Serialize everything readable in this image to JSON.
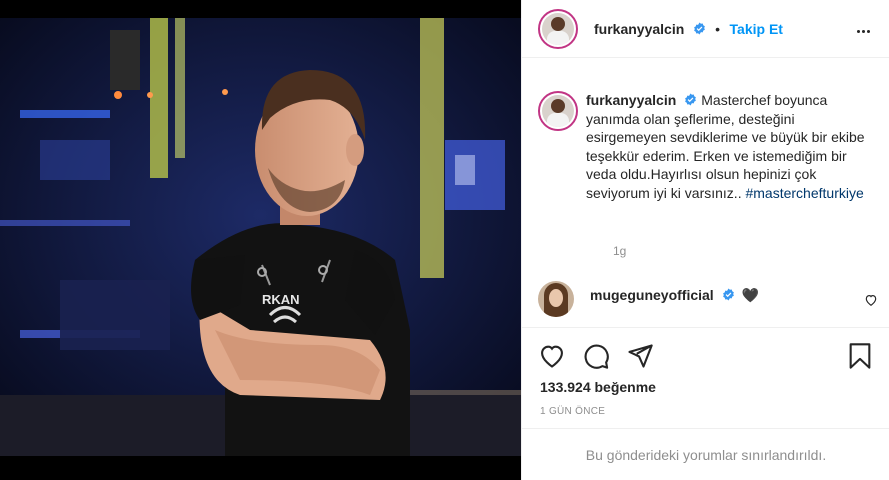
{
  "post": {
    "username": "furkanyyalcin",
    "follow_label": "Takip Et",
    "separator": "•",
    "caption": "Masterchef boyunca yanımda olan şeflerime, desteğini esirgemeyen sevdiklerime ve büyük bir ekibe teşekkür ederim. Erken ve istemediğim bir veda oldu.Hayırlısı olsun hepinizi çok seviyorum iyi ki varsınız..",
    "hashtag": "#masterchefturkiye",
    "hashtag_display": "#masterchefturkiye",
    "caption_time": "1g",
    "likes": "133.924 beğenme",
    "date": "1 GÜN ÖNCE",
    "comments_restricted": "Bu gönderideki yorumlar sınırlandırıldı.",
    "image_text": "RKAN"
  },
  "comments": [
    {
      "username": "mugeguneyofficial",
      "emoji": "🖤"
    }
  ],
  "icons": {
    "verified": "verified-badge-icon",
    "more": "more-options-icon",
    "like": "heart-icon",
    "comment": "comment-icon",
    "share": "share-icon",
    "save": "bookmark-icon"
  },
  "colors": {
    "accent": "#0095f6",
    "verified": "#3897f0",
    "text": "#262626",
    "muted": "#8e8e8e",
    "hashtag": "#00376b"
  }
}
